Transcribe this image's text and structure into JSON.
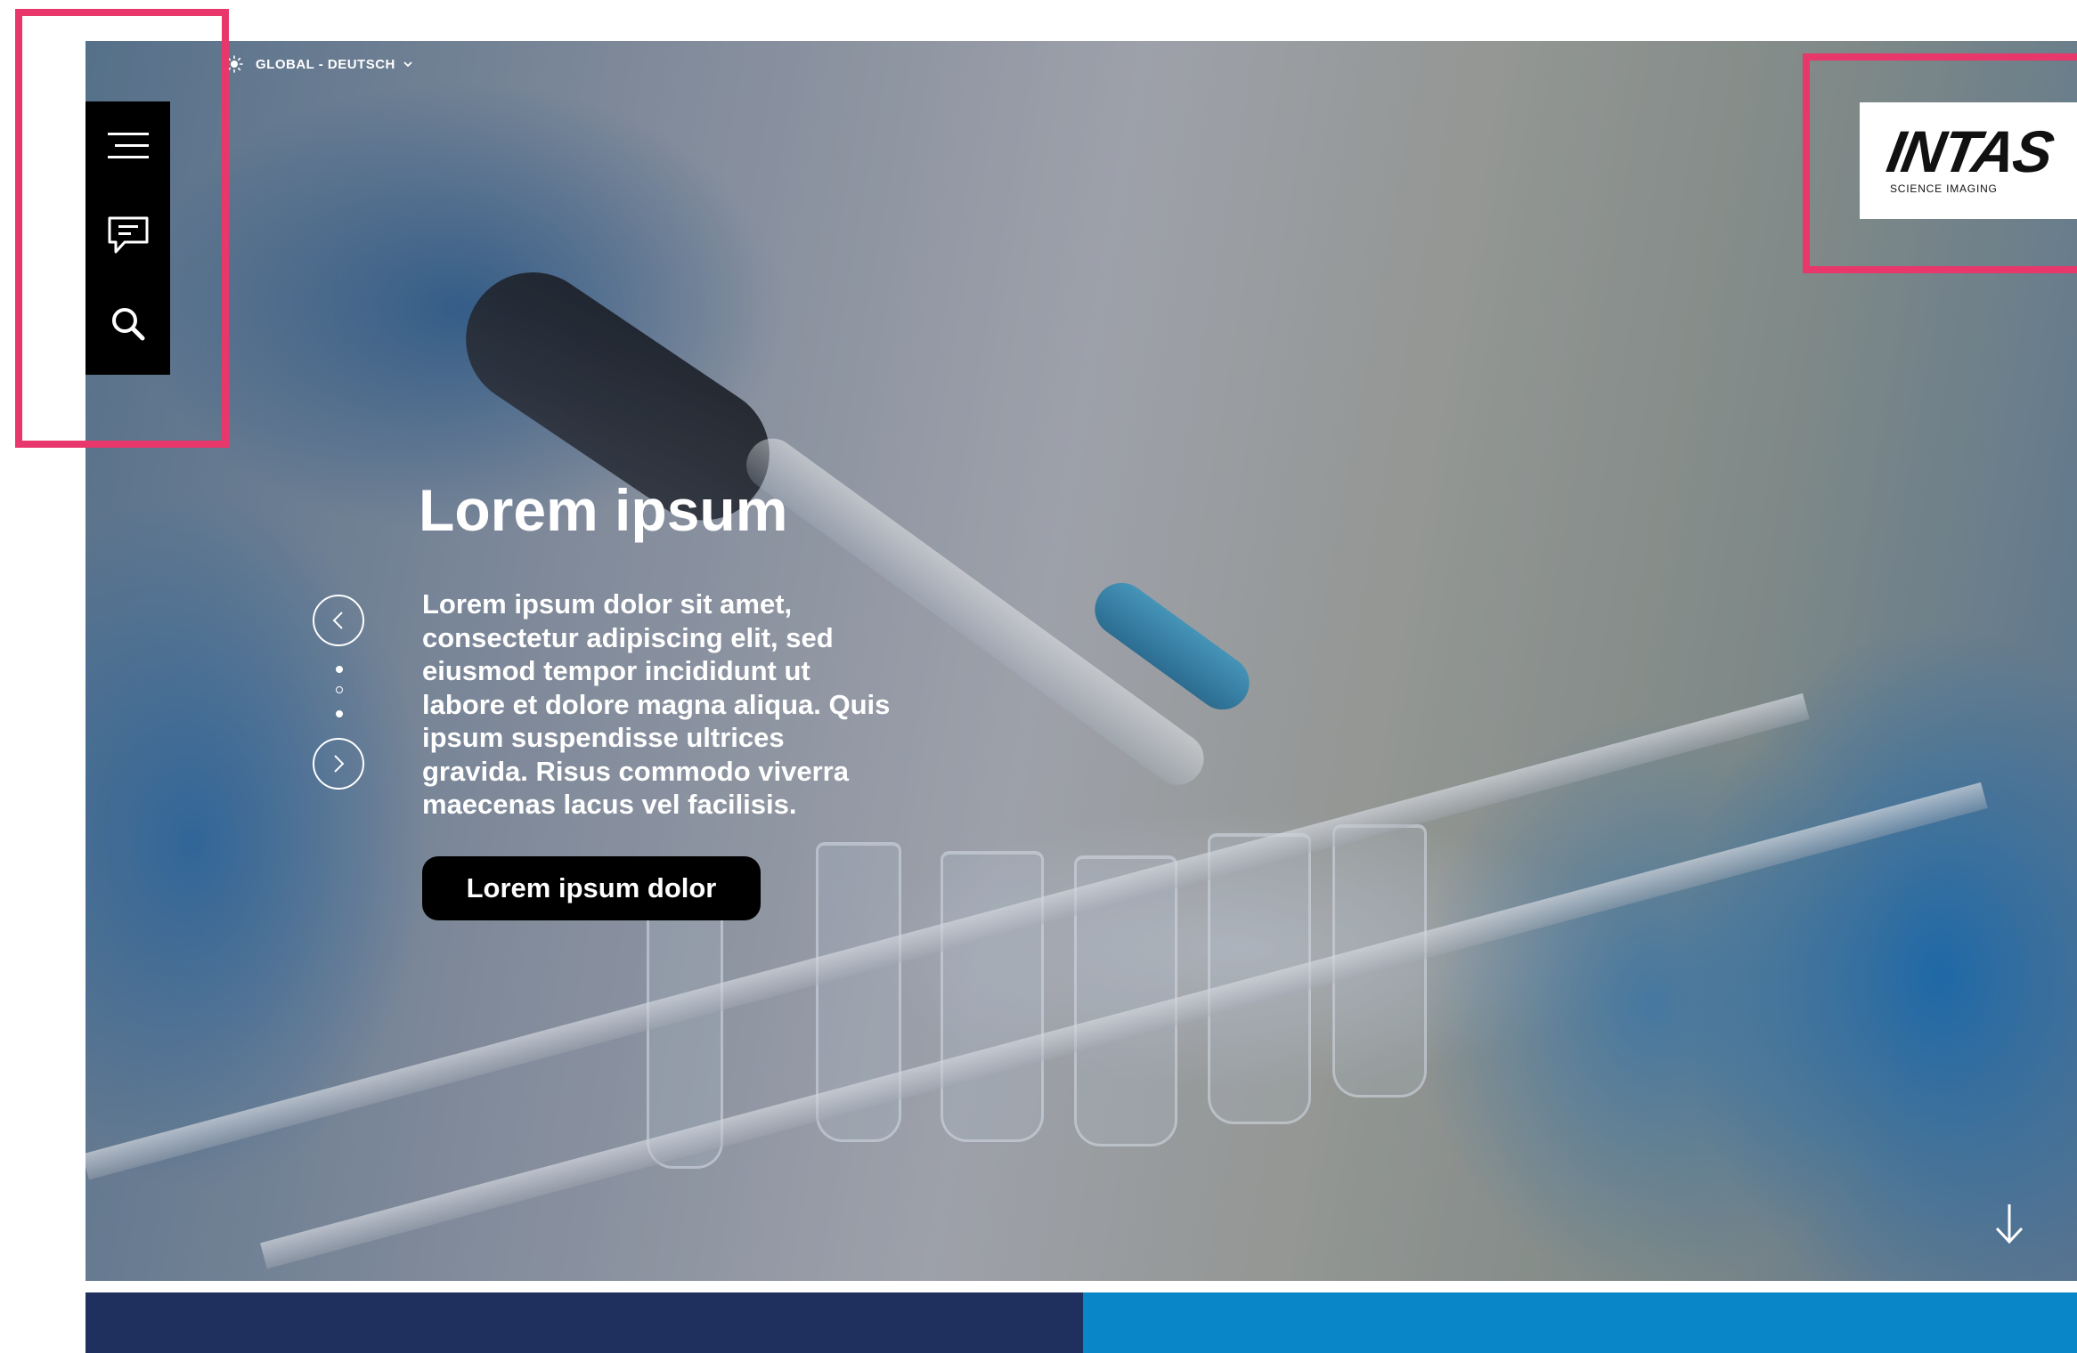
{
  "header": {
    "language_selector": "GLOBAL - DEUTSCH"
  },
  "sidebar": {
    "items": [
      {
        "name": "menu",
        "icon": "hamburger-menu-icon"
      },
      {
        "name": "contact",
        "icon": "chat-bubble-icon"
      },
      {
        "name": "search",
        "icon": "search-icon"
      }
    ]
  },
  "logo": {
    "wordmark": "INTAS",
    "tagline": "SCIENCE IMAGING"
  },
  "hero": {
    "title": "Lorem ipsum",
    "text": "Lorem ipsum dolor sit amet, consectetur adipiscing elit, sed eiusmod tempor incididunt ut labore et dolore magna aliqua. Quis ipsum suspendisse ultrices gravida. Risus commodo viverra maecenas lacus vel facilisis.",
    "button_label": "Lorem ipsum dolor",
    "slider": {
      "slide_count": 3,
      "active_slide": 2
    }
  },
  "colors": {
    "highlight": "#e8376a",
    "navy": "#20305e",
    "blue": "#0886c8",
    "sidebar_bg": "#000000"
  }
}
